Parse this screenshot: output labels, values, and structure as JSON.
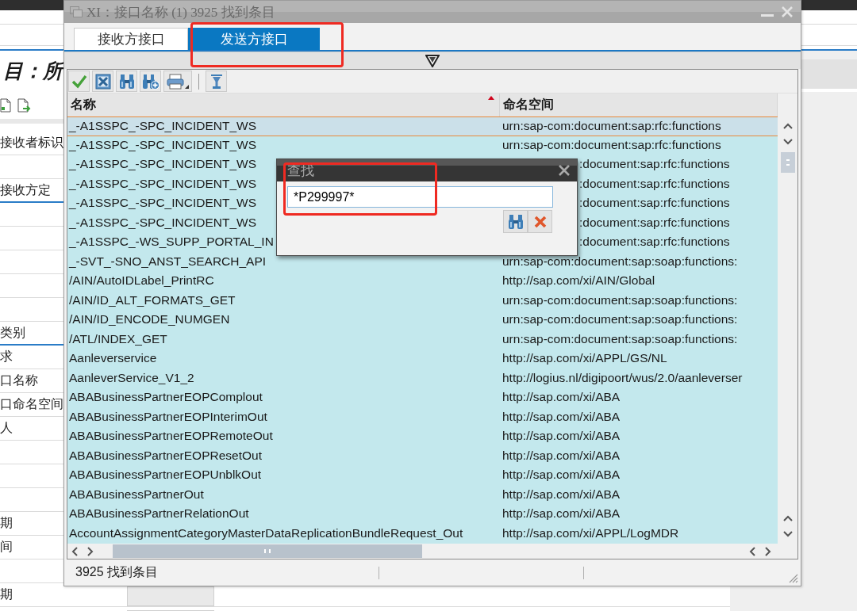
{
  "background": {
    "heading": "目：所",
    "toolbar": [
      {
        "kind": "document"
      },
      {
        "kind": "document_arrow"
      }
    ],
    "rows": [
      {
        "kind": "row",
        "label": "接收者标识"
      },
      {
        "kind": "row"
      },
      {
        "kind": "section",
        "label": "接收方定"
      },
      {
        "kind": "row"
      },
      {
        "kind": "row"
      },
      {
        "kind": "row"
      },
      {
        "kind": "row"
      },
      {
        "kind": "row"
      },
      {
        "kind": "section",
        "label": "类别"
      },
      {
        "kind": "row",
        "label": "求"
      },
      {
        "kind": "row",
        "label": "口名称"
      },
      {
        "kind": "row",
        "label": "口命名空间"
      },
      {
        "kind": "row",
        "label": "人"
      },
      {
        "kind": "row"
      },
      {
        "kind": "row"
      },
      {
        "kind": "row"
      },
      {
        "kind": "row",
        "label": "期"
      },
      {
        "kind": "row",
        "label": "间"
      },
      {
        "kind": "row"
      },
      {
        "kind": "field",
        "label": "期"
      },
      {
        "kind": "field"
      }
    ]
  },
  "dialog": {
    "title": "XI：接口名称 (1) 3925 找到条目",
    "tabs": [
      {
        "label": "接收方接口",
        "selected": false,
        "highlighted": false
      },
      {
        "label": "发送方接口",
        "selected": true,
        "highlighted": true
      }
    ],
    "toolbar": [
      {
        "kind": "confirm"
      },
      {
        "kind": "cancel"
      },
      {
        "kind": "find"
      },
      {
        "kind": "find_next"
      },
      {
        "kind": "print"
      },
      {
        "kind": "separator"
      },
      {
        "kind": "filter"
      }
    ],
    "table": {
      "columns": [
        {
          "label": "名称",
          "sorted": true
        },
        {
          "label": "命名空间",
          "sorted": false
        }
      ],
      "rows": [
        {
          "name": "_-A1SSPC_-SPC_INCIDENT_WS",
          "namespace": "urn:sap-com:document:sap:rfc:functions",
          "selected": true
        },
        {
          "name": "_-A1SSPC_-SPC_INCIDENT_WS",
          "namespace": "urn:sap-com:document:sap:rfc:functions",
          "selected": false
        },
        {
          "name": "_-A1SSPC_-SPC_INCIDENT_WS",
          "namespace": ":document:sap:rfc:functions",
          "namespace_clipped": true,
          "selected": false
        },
        {
          "name": "_-A1SSPC_-SPC_INCIDENT_WS",
          "namespace": ":document:sap:rfc:functions",
          "namespace_clipped": true,
          "selected": false
        },
        {
          "name": "_-A1SSPC_-SPC_INCIDENT_WS",
          "namespace": ":document:sap:rfc:functions",
          "namespace_clipped": true,
          "selected": false
        },
        {
          "name": "_-A1SSPC_-SPC_INCIDENT_WS",
          "namespace": ":document:sap:rfc:functions",
          "namespace_clipped": true,
          "selected": false
        },
        {
          "name": "_-A1SSPC_-WS_SUPP_PORTAL_IN",
          "namespace": ":document:sap:rfc:functions",
          "namespace_clipped": true,
          "selected": false
        },
        {
          "name": "_-SVT_-SNO_ANST_SEARCH_API",
          "namespace": "urn:sap-com:document:sap:soap:functions:",
          "selected": false
        },
        {
          "name": "/AIN/AutoIDLabel_PrintRC",
          "namespace": "http://sap.com/xi/AIN/Global",
          "selected": false
        },
        {
          "name": "/AIN/ID_ALT_FORMATS_GET",
          "namespace": "urn:sap-com:document:sap:soap:functions:",
          "selected": false
        },
        {
          "name": "/AIN/ID_ENCODE_NUMGEN",
          "namespace": "urn:sap-com:document:sap:soap:functions:",
          "selected": false
        },
        {
          "name": "/ATL/INDEX_GET",
          "namespace": "urn:sap-com:document:sap:soap:functions:",
          "selected": false
        },
        {
          "name": "Aanleverservice",
          "namespace": "http://sap.com/xi/APPL/GS/NL",
          "selected": false
        },
        {
          "name": "AanleverService_V1_2",
          "namespace": "http://logius.nl/digipoort/wus/2.0/aanleverser",
          "selected": false
        },
        {
          "name": "ABABusinessPartnerEOPComplout",
          "namespace": "http://sap.com/xi/ABA",
          "selected": false
        },
        {
          "name": "ABABusinessPartnerEOPInterimOut",
          "namespace": "http://sap.com/xi/ABA",
          "selected": false
        },
        {
          "name": "ABABusinessPartnerEOPRemoteOut",
          "namespace": "http://sap.com/xi/ABA",
          "selected": false
        },
        {
          "name": "ABABusinessPartnerEOPResetOut",
          "namespace": "http://sap.com/xi/ABA",
          "selected": false
        },
        {
          "name": "ABABusinessPartnerEOPUnblkOut",
          "namespace": "http://sap.com/xi/ABA",
          "selected": false
        },
        {
          "name": "ABABusinessPartnerOut",
          "namespace": "http://sap.com/xi/ABA",
          "selected": false
        },
        {
          "name": "ABABusinessPartnerRelationOut",
          "namespace": "http://sap.com/xi/ABA",
          "selected": false
        },
        {
          "name": "AccountAssignmentCategoryMasterDataReplicationBundleRequest_Out",
          "namespace": "http://sap.com/xi/APPL/LogMDR",
          "selected": false
        }
      ]
    },
    "status_bar": "3925 找到条目"
  },
  "find_dialog": {
    "title": "查找",
    "field": {
      "value": "*P299997*",
      "highlighted": true
    },
    "buttons": [
      {
        "kind": "find"
      },
      {
        "kind": "cancel"
      }
    ]
  }
}
